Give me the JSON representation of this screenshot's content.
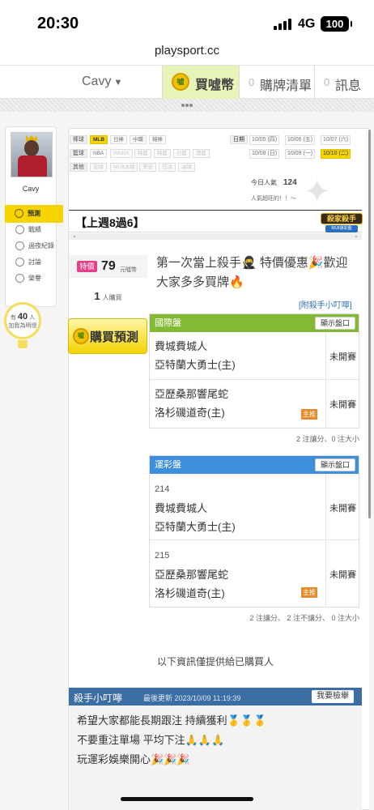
{
  "status": {
    "time": "20:30",
    "network": "4G",
    "battery": "100"
  },
  "browser": {
    "url": "playsport.cc"
  },
  "nav": {
    "user": "Cavy",
    "buy_label": "買噓幣",
    "coin_text": "噓",
    "cart_count": "0",
    "cart_label": "購牌清單",
    "msg_count": "0",
    "msg_label": "訊息"
  },
  "sidebar": {
    "name": "Cavy",
    "items": [
      {
        "label": "預測",
        "active": true
      },
      {
        "label": "戰績"
      },
      {
        "label": "過夜紀錄"
      },
      {
        "label": "討論"
      },
      {
        "label": "榮譽"
      }
    ],
    "bulb_prefix": "有",
    "bulb_count": "40",
    "bulb_suffix": "人",
    "bulb_line2": "加我為明燈"
  },
  "filters": {
    "row1_label": "棒球",
    "row1": [
      "MLB",
      "日棒",
      "中職",
      "韓棒"
    ],
    "row2_label": "籃球",
    "row2": [
      "NBA",
      "WNBA",
      "韓籃",
      "韓籃",
      "日籃",
      "澳籃"
    ],
    "row3_label": "其他",
    "row3": [
      "足球",
      "MLB冰球",
      "美足",
      "日冰",
      "冰球"
    ],
    "date_label": "日期",
    "dates": [
      "10/05 (四)",
      "10/06 (五)",
      "10/07 (六)",
      "10/08 (日)",
      "10/09 (一)",
      "10/10 (二)"
    ]
  },
  "popularity": {
    "label": "今日人氣",
    "value": "124",
    "sub": "人氣超旺的！！～"
  },
  "week": {
    "title": "【上週8過6】",
    "badge": "殺家殺手",
    "badge_sub": "MLB運彩盤"
  },
  "price": {
    "tag": "特價",
    "value": "79",
    "unit": "元噓幣"
  },
  "buyers": {
    "count": "1",
    "unit": "人購買"
  },
  "buy_button": "購買預測",
  "promo": "第一次當上殺手🥷 特價優惠🎉歡迎大家多多買牌🔥",
  "tip_link": "[附殺手小叮嚀]",
  "intl": {
    "title": "國際盤",
    "show": "顯示盤口",
    "games": [
      {
        "team1": "費城費城人",
        "team2": "亞特蘭大勇士(主)",
        "status": "未開賽",
        "pin": ""
      },
      {
        "team1": "亞歷桑那響尾蛇",
        "team2": "洛杉磯道奇(主)",
        "status": "未開賽",
        "pin": "主推"
      }
    ],
    "summary": "2 注讓分、0 注大小"
  },
  "lottery": {
    "title": "運彩盤",
    "show": "顯示盤口",
    "games": [
      {
        "num": "214",
        "team1": "費城費城人",
        "team2": "亞特蘭大勇士(主)",
        "status": "未開賽",
        "pin": ""
      },
      {
        "num": "215",
        "team1": "亞歷桑那響尾蛇",
        "team2": "洛杉磯道奇(主)",
        "status": "未開賽",
        "pin": "主推"
      }
    ],
    "summary": "2 注讓分、 2 注不讓分、 0 注大小"
  },
  "buyer_note": "以下資訊僅提供給已購買人",
  "tips": {
    "title": "殺手小叮嚀",
    "updated": "最後更新 2023/10/09 11:19:39",
    "report": "我要檢舉",
    "lines": [
      "希望大家都能長期跟注 持續獲利🥇🥇🥇",
      "不要重注單場 平均下注🙏🙏🙏",
      "玩運彩娛樂開心🎉🎉🎉"
    ]
  }
}
